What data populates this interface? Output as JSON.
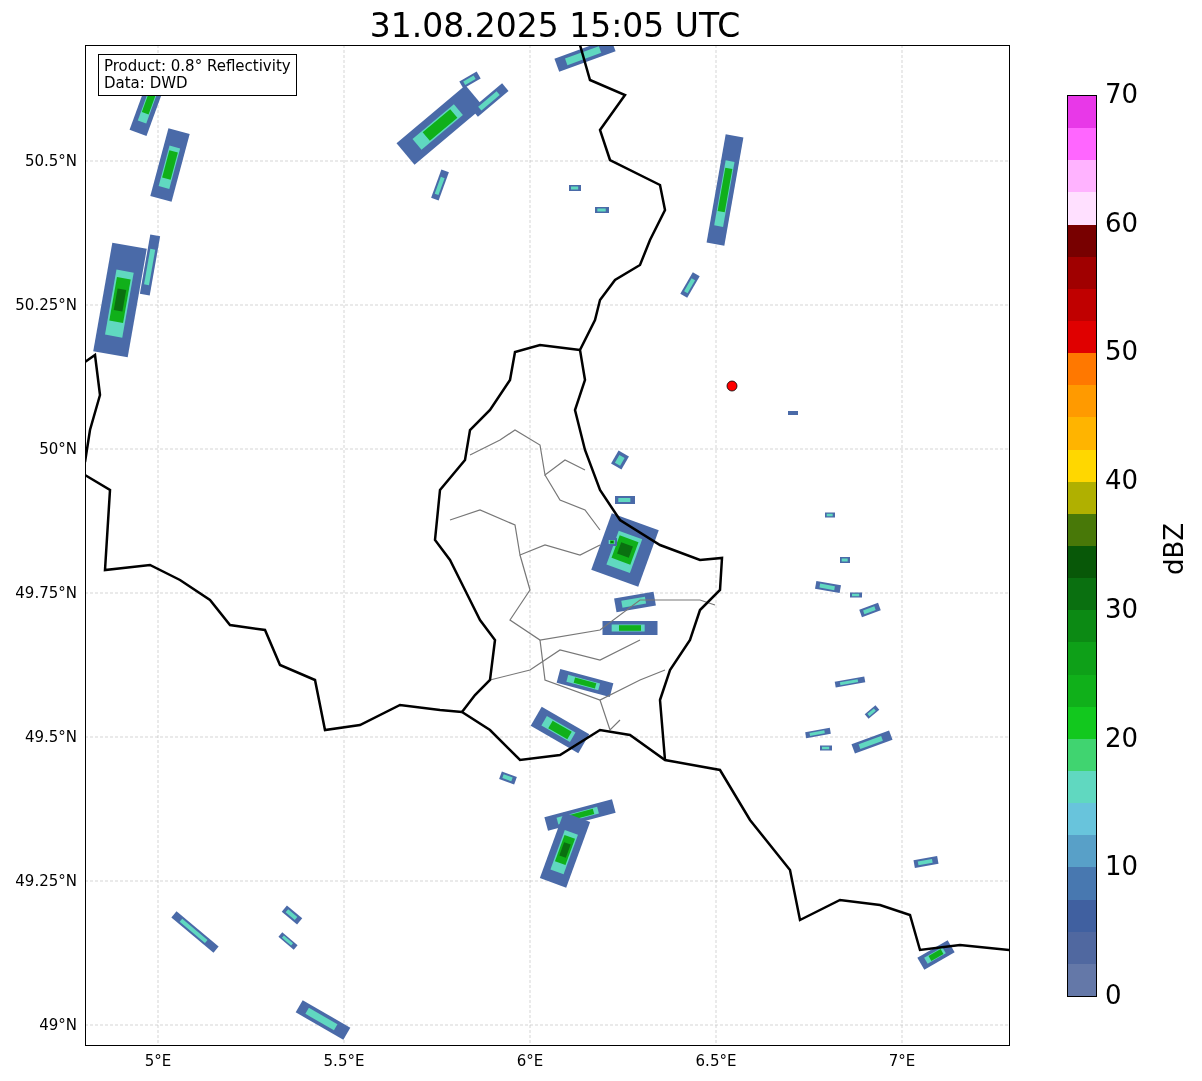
{
  "title": "31.08.2025 15:05 UTC",
  "annotation": [
    "Product: 0.8° Reflectivity",
    "Data: DWD"
  ],
  "map": {
    "y_ticks": [
      "50.5°N",
      "50.25°N",
      "50°N",
      "49.75°N",
      "49.5°N",
      "49.25°N",
      "49°N"
    ],
    "x_ticks": [
      "5°E",
      "5.5°E",
      "6°E",
      "6.5°E",
      "7°E"
    ]
  },
  "colorbar": {
    "label": "dBZ",
    "ticks": [
      "70",
      "60",
      "50",
      "40",
      "30",
      "20",
      "10",
      "0"
    ],
    "segments": [
      {
        "color": "#6478a8"
      },
      {
        "color": "#5068a0"
      },
      {
        "color": "#4060a0"
      },
      {
        "color": "#4878b0"
      },
      {
        "color": "#58a0c8"
      },
      {
        "color": "#68c4dc"
      },
      {
        "color": "#60d8c0"
      },
      {
        "color": "#40d470"
      },
      {
        "color": "#12c81e"
      },
      {
        "color": "#10b01a"
      },
      {
        "color": "#0ea018"
      },
      {
        "color": "#0c8a14"
      },
      {
        "color": "#0a7010"
      },
      {
        "color": "#085808"
      },
      {
        "color": "#487808"
      },
      {
        "color": "#b0b000"
      },
      {
        "color": "#ffd700"
      },
      {
        "color": "#ffb400"
      },
      {
        "color": "#ff9a00"
      },
      {
        "color": "#ff7800"
      },
      {
        "color": "#e00000"
      },
      {
        "color": "#c00000"
      },
      {
        "color": "#a00000"
      },
      {
        "color": "#780000"
      },
      {
        "color": "#ffe0ff"
      },
      {
        "color": "#ffb3ff"
      },
      {
        "color": "#ff66ff"
      },
      {
        "color": "#e838e8"
      }
    ]
  }
}
